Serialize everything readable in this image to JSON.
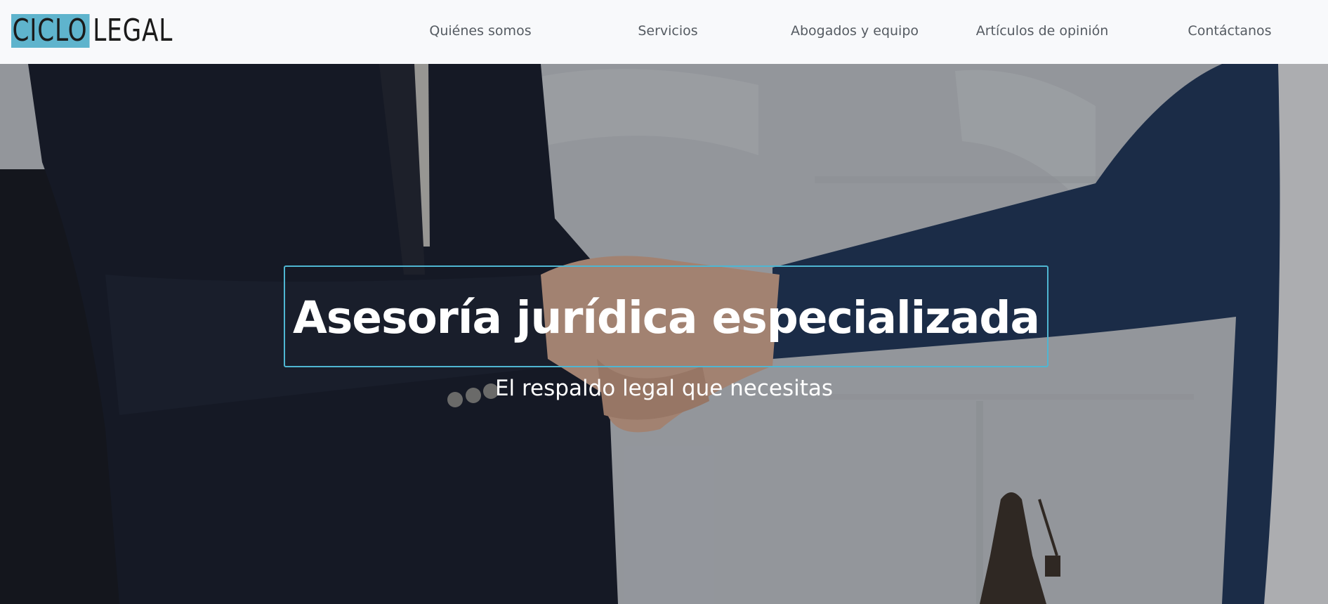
{
  "brand": {
    "logo_part1": "CICLO",
    "logo_part2": "LEGAL",
    "accent_color": "#5fb4cd"
  },
  "nav": {
    "items": [
      {
        "label": "Quiénes somos"
      },
      {
        "label": "Servicios"
      },
      {
        "label": "Abogados y equipo"
      },
      {
        "label": "Artículos de opinión"
      },
      {
        "label": "Contáctanos"
      }
    ]
  },
  "hero": {
    "title": "Asesoría jurídica especializada",
    "subtitle": "El respaldo legal que necesitas",
    "image_subject": "handshake-photo",
    "box_border_color": "#4fb6d2"
  }
}
